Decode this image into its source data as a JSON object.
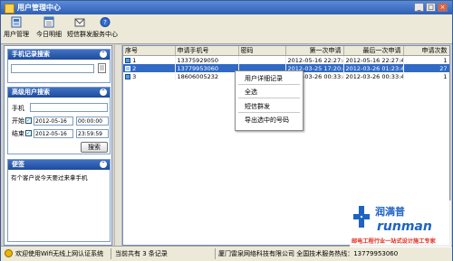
{
  "window": {
    "title": "用户管理中心"
  },
  "toolbar": {
    "items": [
      {
        "label": "用户管理",
        "icon": "user-manage-icon"
      },
      {
        "label": "今日明细",
        "icon": "daily-detail-icon"
      },
      {
        "label": "短信群发",
        "icon": "envelope-icon"
      },
      {
        "label": "服务中心",
        "icon": "help-icon"
      }
    ]
  },
  "phone_search": {
    "title": "手机记录搜索",
    "value": ""
  },
  "advanced_search": {
    "title": "高级用户搜索",
    "phone_label": "手机",
    "phone_value": "",
    "start_label": "开始",
    "start_date": "2012-05-16",
    "start_time": "00:00:00",
    "end_label": "结束",
    "end_date": "2012-05-16",
    "end_time": "23:59:59",
    "search_button": "搜索"
  },
  "memo": {
    "title": "便签",
    "text": "有个客户说今天要过来拿手机"
  },
  "table": {
    "headers": [
      "序号",
      "申请手机号",
      "密码",
      "第一次申请",
      "最后一次申请",
      "申请次数"
    ],
    "rows": [
      {
        "no": "1",
        "phone": "13375929050",
        "pwd": "",
        "first": "2012-05-16 22:27:48",
        "last": "2012-05-16 22:27:48",
        "count": "1"
      },
      {
        "no": "2",
        "phone": "13779953060",
        "pwd": "",
        "first": "2012-03-25 17:20:41",
        "last": "2012-03-26 01:23:46",
        "count": "27"
      },
      {
        "no": "3",
        "phone": "18606005232",
        "pwd": "",
        "first": "2012-03-26 00:33:47",
        "last": "2012-03-26 00:33:47",
        "count": "1"
      }
    ]
  },
  "context_menu": {
    "items": [
      "用户详细记录",
      "全选",
      "短信群发",
      "导出选中的号码"
    ]
  },
  "status": {
    "left": "欢迎使用Wifi无线上网认证系统",
    "count": "当前共有 3 条记录",
    "company": "厦门雷泉网络科技有限公司 全国技术服务热线：13779953060"
  },
  "brand": {
    "name": "润满普",
    "english": "runman",
    "slogan": "邮电工程行业一站式设计施工专家",
    "accent": "#1e63c4",
    "secondary": "#e0301e"
  }
}
